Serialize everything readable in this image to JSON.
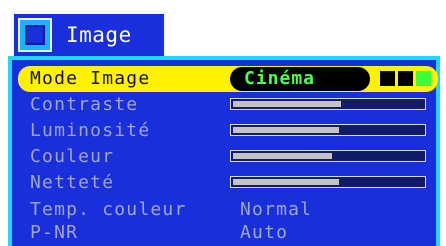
{
  "menu": {
    "title": "Image",
    "colors": {
      "panel_bg": "#1a2fdc",
      "border": "#25d4ff",
      "highlight": "#fff200",
      "selected_value": "#4dff4d",
      "label_text": "#9fa6c8"
    },
    "tab_icon": "picture-frame-icon",
    "items": [
      {
        "label": "Mode Image",
        "value": "Cinéma",
        "indicators": [
          "#000000",
          "#000000",
          "#3bff3b"
        ]
      },
      {
        "label": "Contraste",
        "level": 0.57
      },
      {
        "label": "Luminosité",
        "level": 0.56
      },
      {
        "label": "Couleur",
        "level": 0.52
      },
      {
        "label": "Netteté",
        "level": 0.56
      },
      {
        "label": "Temp. couleur",
        "value": "Normal"
      },
      {
        "label": "P-NR",
        "value": "Auto"
      }
    ]
  }
}
